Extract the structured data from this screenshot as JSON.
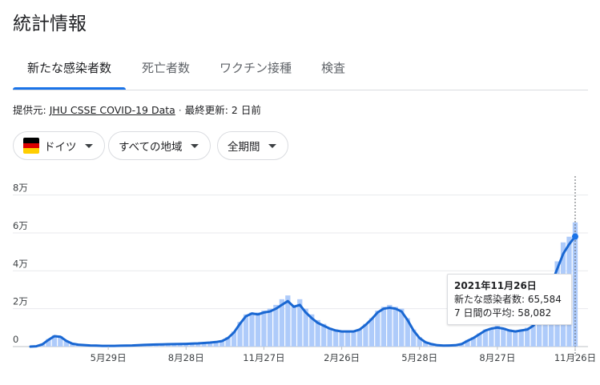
{
  "page_title": "統計情報",
  "tabs": [
    {
      "label": "新たな感染者数",
      "active": true
    },
    {
      "label": "死亡者数",
      "active": false
    },
    {
      "label": "ワクチン接種",
      "active": false
    },
    {
      "label": "検査",
      "active": false
    }
  ],
  "source": {
    "prefix": "提供元: ",
    "link": "JHU CSSE COVID-19 Data",
    "separator": " · ",
    "updated": "最終更新: 2 日前"
  },
  "filters": {
    "country": "ドイツ",
    "region": "すべての地域",
    "period": "全期間"
  },
  "colors": {
    "accent": "#1a73e8",
    "line": "#1967d2",
    "bars": "#aecbfa",
    "flag": [
      "#000000",
      "#dd0000",
      "#ffce00"
    ]
  },
  "tooltip": {
    "date": "2021年11月26日",
    "new_cases": "新たな感染者数: 65,584",
    "avg7": "7 日間の平均: 58,082"
  },
  "chart_data": {
    "type": "bar",
    "title": "",
    "xlabel": "",
    "ylabel": "",
    "ylim": [
      0,
      90000
    ],
    "y_ticks": [
      {
        "value": 0,
        "label": "0"
      },
      {
        "value": 20000,
        "label": "2万"
      },
      {
        "value": 40000,
        "label": "4万"
      },
      {
        "value": 60000,
        "label": "6万"
      },
      {
        "value": 80000,
        "label": "8万"
      }
    ],
    "x_ticks": [
      {
        "week": 13,
        "label": "5月29日"
      },
      {
        "week": 26,
        "label": "8月28日"
      },
      {
        "week": 39,
        "label": "11月27日"
      },
      {
        "week": 52,
        "label": "2月26日"
      },
      {
        "week": 65,
        "label": "5月28日"
      },
      {
        "week": 78,
        "label": "8月27日"
      },
      {
        "week": 91,
        "label": "11月26日"
      }
    ],
    "grid": true,
    "series": [
      {
        "name": "新たな感染者数",
        "kind": "bar",
        "start": "2020-02-29",
        "step_days": 7,
        "values": [
          0,
          200,
          1500,
          4000,
          6000,
          5500,
          3000,
          1500,
          1000,
          800,
          600,
          500,
          400,
          400,
          400,
          500,
          500,
          600,
          800,
          900,
          1100,
          1200,
          1300,
          1300,
          1300,
          1400,
          1500,
          1600,
          1800,
          2000,
          2200,
          2500,
          3000,
          5000,
          8000,
          13000,
          17000,
          18000,
          18000,
          19000,
          20000,
          22000,
          25000,
          27000,
          22000,
          25000,
          20000,
          17000,
          14000,
          12000,
          10000,
          9000,
          8000,
          8000,
          8000,
          9000,
          12000,
          15000,
          19000,
          21000,
          22000,
          21000,
          20000,
          15000,
          9000,
          5000,
          2500,
          1500,
          800,
          600,
          700,
          800,
          1500,
          3500,
          5000,
          7000,
          9000,
          10000,
          11000,
          10000,
          9000,
          8000,
          9000,
          10000,
          12000,
          17000,
          26000,
          36000,
          45000,
          55000,
          58000,
          65584
        ]
      },
      {
        "name": "7 日間の平均",
        "kind": "line",
        "start": "2020-02-29",
        "step_days": 7,
        "values": [
          0,
          150,
          1200,
          3500,
          5500,
          5200,
          3000,
          1500,
          1000,
          800,
          600,
          500,
          400,
          400,
          400,
          450,
          500,
          600,
          750,
          900,
          1000,
          1100,
          1200,
          1250,
          1300,
          1350,
          1450,
          1550,
          1700,
          1900,
          2100,
          2400,
          2900,
          4500,
          7500,
          12000,
          16000,
          17500,
          17000,
          18000,
          18500,
          20000,
          22000,
          24000,
          21000,
          22000,
          18000,
          15000,
          12500,
          11000,
          9500,
          8500,
          8000,
          8000,
          8000,
          9000,
          11500,
          14500,
          18000,
          20000,
          20500,
          20000,
          18500,
          14000,
          8500,
          4500,
          2300,
          1300,
          700,
          500,
          600,
          700,
          1300,
          3000,
          4500,
          6500,
          8500,
          9500,
          10000,
          9500,
          8500,
          8000,
          8500,
          9000,
          11000,
          15500,
          24000,
          33000,
          41000,
          49000,
          54000,
          58082
        ]
      }
    ]
  }
}
